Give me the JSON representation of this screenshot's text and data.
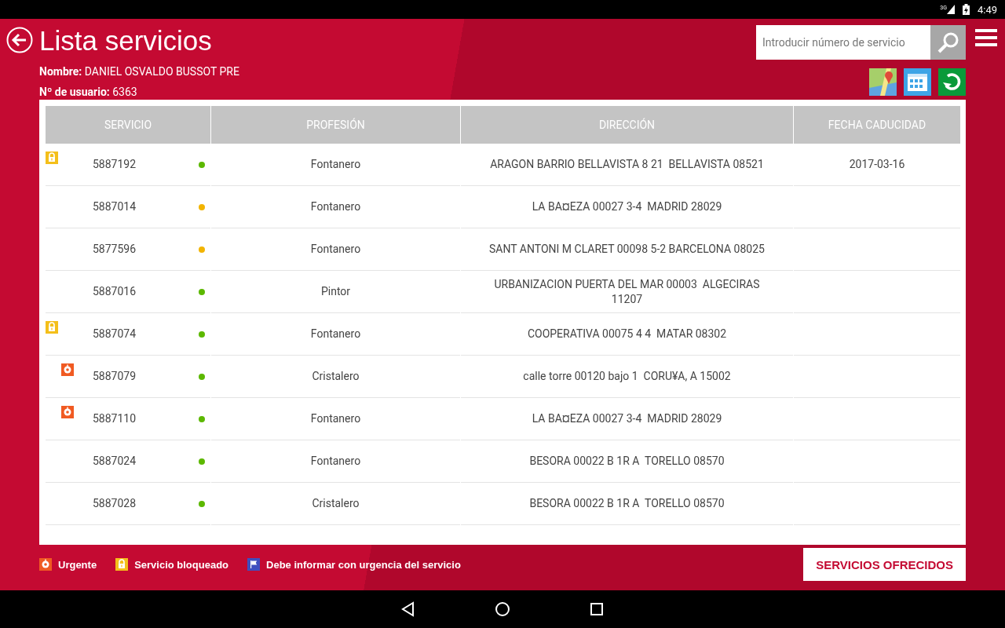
{
  "status_bar": {
    "network": "3G",
    "time": "4:49"
  },
  "header": {
    "title_bold": "Lista",
    "title_light": "servicios",
    "name_label": "Nombre:",
    "name_value": "DANIEL OSVALDO BUSSOT PRE",
    "user_label": "Nº de usuario:",
    "user_value": "6363"
  },
  "search": {
    "placeholder": "Introducir número de servicio"
  },
  "table": {
    "columns": [
      "SERVICIO",
      "PROFESIÓN",
      "DIRECCIÓN",
      "FECHA CADUCIDAD"
    ],
    "rows": [
      {
        "kind": "locked",
        "servicio": "5887192",
        "color": "#5cb800",
        "profesion": "Fontanero",
        "direccion": "ARAGON BARRIO BELLAVISTA 8 21  BELLAVISTA 08521",
        "fecha": "2017-03-16"
      },
      {
        "kind": "normal",
        "servicio": "5887014",
        "color": "#f2b400",
        "profesion": "Fontanero",
        "direccion": "LA BA¤EZA 00027 3-4  MADRID 28029"
      },
      {
        "kind": "normal",
        "servicio": "5877596",
        "color": "#f2b400",
        "profesion": "Fontanero",
        "direccion": "SANT ANTONI M CLARET 00098 5-2 BARCELONA 08025"
      },
      {
        "kind": "normal",
        "servicio": "5887016",
        "color": "#5cb800",
        "profesion": "Pintor",
        "direccion": "URBANIZACION PUERTA DEL MAR 00003  ALGECIRAS 11207"
      },
      {
        "kind": "locked",
        "servicio": "5887074",
        "color": "#5cb800",
        "profesion": "Fontanero",
        "direccion": "COOPERATIVA 00075 4 4  MATAR 08302"
      },
      {
        "kind": "urgent",
        "servicio": "5887079",
        "color": "#5cb800",
        "profesion": "Cristalero",
        "direccion": "calle torre 00120 bajo 1  CORU¥A, A 15002"
      },
      {
        "kind": "urgent",
        "servicio": "5887110",
        "color": "#5cb800",
        "profesion": "Fontanero",
        "direccion": "LA BA¤EZA 00027 3-4  MADRID 28029"
      },
      {
        "kind": "normal",
        "servicio": "5887024",
        "color": "#5cb800",
        "profesion": "Fontanero",
        "direccion": "BESORA 00022 B 1R A  TORELLO 08570"
      },
      {
        "kind": "normal",
        "servicio": "5887028",
        "color": "#5cb800",
        "profesion": "Cristalero",
        "direccion": "BESORA 00022 B 1R A  TORELLO 08570"
      }
    ]
  },
  "legend": [
    {
      "kind": "urgent",
      "label": "Urgente"
    },
    {
      "kind": "locked",
      "label": "Servicio bloqueado"
    },
    {
      "kind": "flag",
      "label": "Debe informar con urgencia del servicio"
    }
  ],
  "action_button": "SERVICIOS OFRECIDOS"
}
